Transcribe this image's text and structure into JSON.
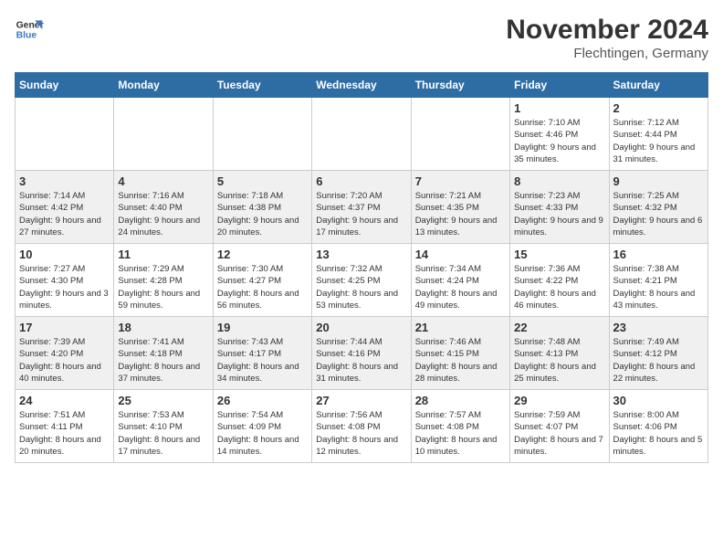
{
  "logo": {
    "line1": "General",
    "line2": "Blue"
  },
  "title": "November 2024",
  "subtitle": "Flechtingen, Germany",
  "days_header": [
    "Sunday",
    "Monday",
    "Tuesday",
    "Wednesday",
    "Thursday",
    "Friday",
    "Saturday"
  ],
  "weeks": [
    [
      {
        "day": "",
        "info": ""
      },
      {
        "day": "",
        "info": ""
      },
      {
        "day": "",
        "info": ""
      },
      {
        "day": "",
        "info": ""
      },
      {
        "day": "",
        "info": ""
      },
      {
        "day": "1",
        "info": "Sunrise: 7:10 AM\nSunset: 4:46 PM\nDaylight: 9 hours and 35 minutes."
      },
      {
        "day": "2",
        "info": "Sunrise: 7:12 AM\nSunset: 4:44 PM\nDaylight: 9 hours and 31 minutes."
      }
    ],
    [
      {
        "day": "3",
        "info": "Sunrise: 7:14 AM\nSunset: 4:42 PM\nDaylight: 9 hours and 27 minutes."
      },
      {
        "day": "4",
        "info": "Sunrise: 7:16 AM\nSunset: 4:40 PM\nDaylight: 9 hours and 24 minutes."
      },
      {
        "day": "5",
        "info": "Sunrise: 7:18 AM\nSunset: 4:38 PM\nDaylight: 9 hours and 20 minutes."
      },
      {
        "day": "6",
        "info": "Sunrise: 7:20 AM\nSunset: 4:37 PM\nDaylight: 9 hours and 17 minutes."
      },
      {
        "day": "7",
        "info": "Sunrise: 7:21 AM\nSunset: 4:35 PM\nDaylight: 9 hours and 13 minutes."
      },
      {
        "day": "8",
        "info": "Sunrise: 7:23 AM\nSunset: 4:33 PM\nDaylight: 9 hours and 9 minutes."
      },
      {
        "day": "9",
        "info": "Sunrise: 7:25 AM\nSunset: 4:32 PM\nDaylight: 9 hours and 6 minutes."
      }
    ],
    [
      {
        "day": "10",
        "info": "Sunrise: 7:27 AM\nSunset: 4:30 PM\nDaylight: 9 hours and 3 minutes."
      },
      {
        "day": "11",
        "info": "Sunrise: 7:29 AM\nSunset: 4:28 PM\nDaylight: 8 hours and 59 minutes."
      },
      {
        "day": "12",
        "info": "Sunrise: 7:30 AM\nSunset: 4:27 PM\nDaylight: 8 hours and 56 minutes."
      },
      {
        "day": "13",
        "info": "Sunrise: 7:32 AM\nSunset: 4:25 PM\nDaylight: 8 hours and 53 minutes."
      },
      {
        "day": "14",
        "info": "Sunrise: 7:34 AM\nSunset: 4:24 PM\nDaylight: 8 hours and 49 minutes."
      },
      {
        "day": "15",
        "info": "Sunrise: 7:36 AM\nSunset: 4:22 PM\nDaylight: 8 hours and 46 minutes."
      },
      {
        "day": "16",
        "info": "Sunrise: 7:38 AM\nSunset: 4:21 PM\nDaylight: 8 hours and 43 minutes."
      }
    ],
    [
      {
        "day": "17",
        "info": "Sunrise: 7:39 AM\nSunset: 4:20 PM\nDaylight: 8 hours and 40 minutes."
      },
      {
        "day": "18",
        "info": "Sunrise: 7:41 AM\nSunset: 4:18 PM\nDaylight: 8 hours and 37 minutes."
      },
      {
        "day": "19",
        "info": "Sunrise: 7:43 AM\nSunset: 4:17 PM\nDaylight: 8 hours and 34 minutes."
      },
      {
        "day": "20",
        "info": "Sunrise: 7:44 AM\nSunset: 4:16 PM\nDaylight: 8 hours and 31 minutes."
      },
      {
        "day": "21",
        "info": "Sunrise: 7:46 AM\nSunset: 4:15 PM\nDaylight: 8 hours and 28 minutes."
      },
      {
        "day": "22",
        "info": "Sunrise: 7:48 AM\nSunset: 4:13 PM\nDaylight: 8 hours and 25 minutes."
      },
      {
        "day": "23",
        "info": "Sunrise: 7:49 AM\nSunset: 4:12 PM\nDaylight: 8 hours and 22 minutes."
      }
    ],
    [
      {
        "day": "24",
        "info": "Sunrise: 7:51 AM\nSunset: 4:11 PM\nDaylight: 8 hours and 20 minutes."
      },
      {
        "day": "25",
        "info": "Sunrise: 7:53 AM\nSunset: 4:10 PM\nDaylight: 8 hours and 17 minutes."
      },
      {
        "day": "26",
        "info": "Sunrise: 7:54 AM\nSunset: 4:09 PM\nDaylight: 8 hours and 14 minutes."
      },
      {
        "day": "27",
        "info": "Sunrise: 7:56 AM\nSunset: 4:08 PM\nDaylight: 8 hours and 12 minutes."
      },
      {
        "day": "28",
        "info": "Sunrise: 7:57 AM\nSunset: 4:08 PM\nDaylight: 8 hours and 10 minutes."
      },
      {
        "day": "29",
        "info": "Sunrise: 7:59 AM\nSunset: 4:07 PM\nDaylight: 8 hours and 7 minutes."
      },
      {
        "day": "30",
        "info": "Sunrise: 8:00 AM\nSunset: 4:06 PM\nDaylight: 8 hours and 5 minutes."
      }
    ]
  ]
}
